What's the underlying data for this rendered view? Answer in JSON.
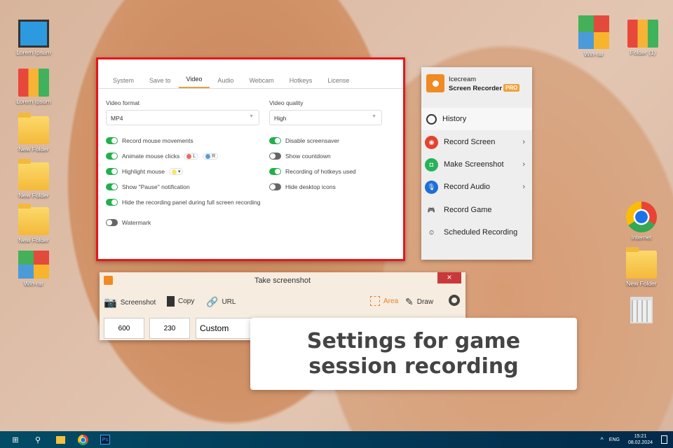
{
  "desktop": {
    "left": [
      {
        "label": "Lorem Ipsum",
        "type": "pc"
      },
      {
        "label": "Lorem Ipsum",
        "type": "books"
      },
      {
        "label": "New Folder",
        "type": "folder"
      },
      {
        "label": "New Folder",
        "type": "folder"
      },
      {
        "label": "New Folder",
        "type": "folder"
      },
      {
        "label": "Win-rar",
        "type": "rar"
      }
    ],
    "right": [
      {
        "label": "Win-rar"
      },
      {
        "label": "Folder (1)"
      },
      {
        "label": "Internet"
      },
      {
        "label": "New Folder"
      }
    ]
  },
  "settings": {
    "tabs": [
      "System",
      "Save to",
      "Video",
      "Audio",
      "Webcam",
      "Hotkeys",
      "License"
    ],
    "active_tab": "Video",
    "video_format_label": "Video format",
    "video_format": "MP4",
    "video_quality_label": "Video quality",
    "video_quality": "High",
    "left_toggles": [
      {
        "label": "Record mouse movements",
        "on": true
      },
      {
        "label": "Animate mouse clicks",
        "on": true
      },
      {
        "label": "Highlight mouse",
        "on": true
      },
      {
        "label": "Show \"Pause\" notification",
        "on": true
      },
      {
        "label": "Hide the recording panel during full screen recording",
        "on": true
      },
      {
        "label": "Watermark",
        "on": false
      }
    ],
    "right_toggles": [
      {
        "label": "Disable screensaver",
        "on": true
      },
      {
        "label": "Show countdown",
        "on": false
      },
      {
        "label": "Recording of hotkeys used",
        "on": true
      },
      {
        "label": "Hide desktop icons",
        "on": false
      }
    ],
    "click_left": "L",
    "click_right": "R",
    "highlight_arrow": "▾"
  },
  "icecream": {
    "brand1": "Icecream",
    "brand2": "Screen Recorder",
    "badge": "PRO",
    "menu": [
      {
        "label": "History"
      },
      {
        "label": "Record Screen",
        "sub": true
      },
      {
        "label": "Make Screenshot",
        "sub": true
      },
      {
        "label": "Record Audio",
        "sub": true
      },
      {
        "label": "Record Game"
      },
      {
        "label": "Scheduled Recording"
      }
    ]
  },
  "screenshot": {
    "title": "Take screenshot",
    "close": "×",
    "screenshot": "Screenshot",
    "copy": "Copy",
    "url": "URL",
    "area": "Area",
    "draw": "Draw",
    "width": "600",
    "height": "230",
    "preset": "Custom"
  },
  "banner": {
    "line1": "Settings for game",
    "line2": "session recording"
  },
  "taskbar": {
    "lang": "ENG",
    "time": "15:21",
    "date": "08.02.2024",
    "caret": "^"
  }
}
